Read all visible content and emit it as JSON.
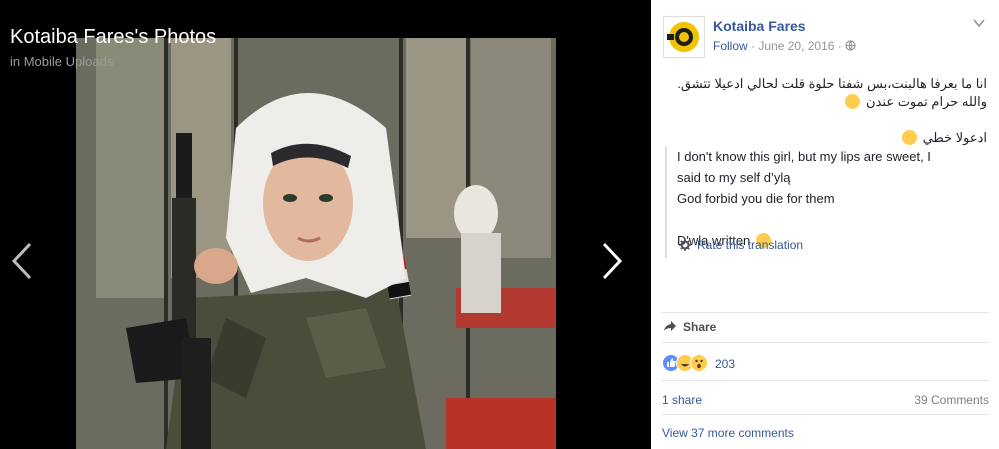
{
  "viewer": {
    "title": "Kotaiba Fares's Photos",
    "album": "in Mobile Uploads"
  },
  "post": {
    "author": "Kotaiba Fares",
    "follow": "Follow",
    "date": "June 20, 2016",
    "sep": "·",
    "arabic_line1": "انا ما بعرفا هالبنت،بس شفتا حلوة قلت لحالي ادعيلا تتشق.",
    "arabic_line2": "والله حرام تموت عندن",
    "arabic_line3": "ادعولا خطي",
    "translation": [
      "I don't know this girl, but my lips are sweet, I",
      "said to my self d’ylą",
      "God forbid you die for them",
      "",
      "D'wlą written"
    ],
    "rate_translation": "Rate this translation",
    "share_label": "Share",
    "reaction_count": "203",
    "shares": "1 share",
    "comments": "39 Comments",
    "view_more": "View 37 more comments"
  },
  "colors": {
    "link": "#365899",
    "text": "#1d2129",
    "muted": "#90949c",
    "like": "#5890ff",
    "emoji": "#ffcc4d"
  },
  "icons": [
    "chevron-left-icon",
    "chevron-right-icon",
    "globe-icon",
    "chevron-down-icon",
    "gear-icon",
    "share-icon",
    "like-reaction-icon",
    "haha-reaction-icon",
    "wow-reaction-icon"
  ]
}
